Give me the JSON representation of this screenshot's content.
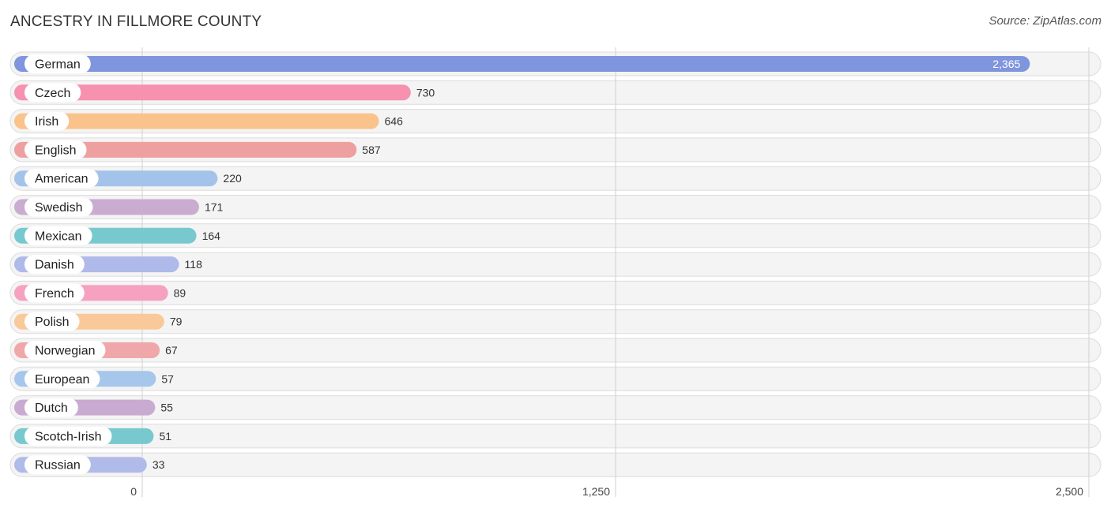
{
  "header": {
    "title": "ANCESTRY IN FILLMORE COUNTY",
    "source": "Source: ZipAtlas.com"
  },
  "chart_data": {
    "type": "bar",
    "orientation": "horizontal",
    "title": "ANCESTRY IN FILLMORE COUNTY",
    "xlabel": "",
    "ylabel": "",
    "xlim": [
      0,
      2500
    ],
    "grid": true,
    "xticks": [
      0,
      1250,
      2500
    ],
    "xtick_labels": [
      "0",
      "1,250",
      "2,500"
    ],
    "categories": [
      "German",
      "Czech",
      "Irish",
      "English",
      "American",
      "Swedish",
      "Mexican",
      "Danish",
      "French",
      "Polish",
      "Norwegian",
      "European",
      "Dutch",
      "Scotch-Irish",
      "Russian"
    ],
    "values": [
      2365,
      730,
      646,
      587,
      220,
      171,
      164,
      118,
      89,
      79,
      67,
      57,
      55,
      51,
      33
    ],
    "value_labels": [
      "2,365",
      "730",
      "646",
      "587",
      "220",
      "171",
      "164",
      "118",
      "89",
      "79",
      "67",
      "57",
      "55",
      "51",
      "33"
    ],
    "colors": [
      "#7f95dd",
      "#f691b0",
      "#f9c38b",
      "#eea0a0",
      "#a4c3ea",
      "#c9acd0",
      "#78c9cf",
      "#afb9ea",
      "#f6a1c0",
      "#f9c999",
      "#f0a7a9",
      "#a6c6ec",
      "#c9abd1",
      "#78c9cf",
      "#b0bbea"
    ]
  }
}
